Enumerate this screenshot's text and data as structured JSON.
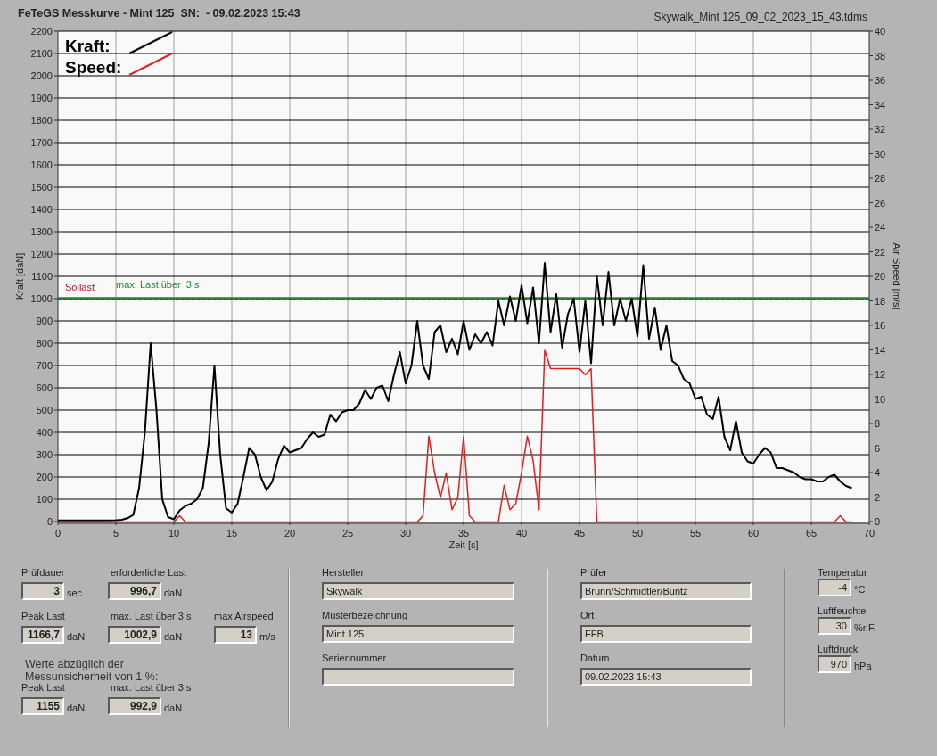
{
  "header": {
    "title": "FeTeGS Messkurve - Mint 125  SN:  - 09.02.2023 15:43",
    "file_name": "Skywalk_Mint 125_09_02_2023_15_43.tdms"
  },
  "chart": {
    "chart_data": {
      "type": "line",
      "xlabel": "Zeit [s]",
      "ylabel": "Kraft [daN]",
      "y2label": "Air Speed [m/s]",
      "xlim": [
        0,
        70
      ],
      "ylim": [
        0,
        2200
      ],
      "y2lim": [
        0,
        40
      ],
      "xticks": [
        0,
        5,
        10,
        15,
        20,
        25,
        30,
        35,
        40,
        45,
        50,
        55,
        60,
        65,
        70
      ],
      "yticks": [
        0,
        100,
        200,
        300,
        400,
        500,
        600,
        700,
        800,
        900,
        1000,
        1100,
        1200,
        1300,
        1400,
        1500,
        1600,
        1700,
        1800,
        1900,
        2000,
        2100,
        2200
      ],
      "y2ticks": [
        0,
        2,
        4,
        6,
        8,
        10,
        12,
        14,
        16,
        18,
        20,
        22,
        24,
        26,
        28,
        30,
        32,
        34,
        36,
        38,
        40
      ],
      "x": [
        0,
        0.5,
        1,
        1.5,
        2,
        2.5,
        3,
        3.5,
        4,
        4.5,
        5,
        5.5,
        6,
        6.5,
        7,
        7.5,
        8,
        8.5,
        9,
        9.5,
        10,
        10.5,
        11,
        11.5,
        12,
        12.5,
        13,
        13.5,
        14,
        14.5,
        15,
        15.5,
        16,
        16.5,
        17,
        17.5,
        18,
        18.5,
        19,
        19.5,
        20,
        20.5,
        21,
        21.5,
        22,
        22.5,
        23,
        23.5,
        24,
        24.5,
        25,
        25.5,
        26,
        26.5,
        27,
        27.5,
        28,
        28.5,
        29,
        29.5,
        30,
        30.5,
        31,
        31.5,
        32,
        32.5,
        33,
        33.5,
        34,
        34.5,
        35,
        35.5,
        36,
        36.5,
        37,
        37.5,
        38,
        38.5,
        39,
        39.5,
        40,
        40.5,
        41,
        41.5,
        42,
        42.5,
        43,
        43.5,
        44,
        44.5,
        45,
        45.5,
        46,
        46.5,
        47,
        47.5,
        48,
        48.5,
        49,
        49.5,
        50,
        50.5,
        51,
        51.5,
        52,
        52.5,
        53,
        53.5,
        54,
        54.5,
        55,
        55.5,
        56,
        56.5,
        57,
        57.5,
        58,
        58.5,
        59,
        59.5,
        60,
        60.5,
        61,
        61.5,
        62,
        62.5,
        63,
        63.5,
        64,
        64.5,
        65,
        65.5,
        66,
        66.5,
        67,
        67.5,
        68,
        68.5
      ],
      "series": [
        {
          "name": "Kraft:",
          "color": "#000000",
          "values": [
            5,
            5,
            5,
            5,
            5,
            5,
            5,
            5,
            5,
            5,
            6,
            8,
            15,
            30,
            150,
            400,
            800,
            500,
            100,
            20,
            10,
            50,
            70,
            80,
            100,
            150,
            350,
            700,
            300,
            60,
            40,
            80,
            200,
            330,
            300,
            200,
            140,
            180,
            280,
            340,
            310,
            320,
            330,
            370,
            400,
            380,
            390,
            480,
            450,
            490,
            500,
            500,
            530,
            590,
            550,
            600,
            610,
            540,
            660,
            760,
            620,
            700,
            900,
            700,
            640,
            850,
            880,
            760,
            820,
            750,
            900,
            770,
            840,
            800,
            850,
            790,
            990,
            880,
            1010,
            900,
            1060,
            890,
            1050,
            800,
            1160,
            850,
            1020,
            780,
            930,
            1000,
            760,
            990,
            710,
            1100,
            880,
            1120,
            880,
            1000,
            900,
            1000,
            830,
            1150,
            820,
            960,
            770,
            880,
            720,
            700,
            640,
            620,
            550,
            560,
            480,
            460,
            560,
            380,
            320,
            450,
            310,
            270,
            260,
            300,
            330,
            310,
            240,
            240,
            230,
            220,
            200,
            190,
            190,
            180,
            180,
            200,
            210,
            180,
            160,
            150
          ]
        },
        {
          "name": "Speed:",
          "color": "#e02020",
          "axis": "y2",
          "values": [
            0,
            0,
            0,
            0,
            0,
            0,
            0,
            0,
            0,
            0,
            0,
            0,
            0,
            0,
            0,
            0,
            0,
            0,
            0,
            0,
            0,
            0.5,
            0,
            0,
            0,
            0,
            0,
            0,
            0,
            0,
            0,
            0,
            0,
            0,
            0,
            0,
            0,
            0,
            0,
            0,
            0,
            0,
            0,
            0,
            0,
            0,
            0,
            0,
            0,
            0,
            0,
            0,
            0,
            0,
            0,
            0,
            0,
            0,
            0,
            0,
            0,
            0,
            0,
            0.5,
            7,
            4,
            2,
            4,
            1,
            2,
            7,
            0.5,
            0,
            0,
            0,
            0,
            0,
            3,
            1,
            1.5,
            4,
            7,
            5,
            1,
            14,
            12.5,
            12.5,
            12.5,
            12.5,
            12.5,
            12.5,
            12,
            12.5,
            0,
            0,
            0,
            0,
            0,
            0,
            0,
            0,
            0,
            0,
            0,
            0,
            0,
            0,
            0,
            0,
            0,
            0,
            0,
            0,
            0,
            0,
            0,
            0,
            0,
            0,
            0,
            0,
            0,
            0,
            0,
            0,
            0,
            0,
            0,
            0,
            0,
            0,
            0,
            0,
            0,
            0,
            0.5,
            0,
            0
          ]
        }
      ],
      "ref_lines": [
        {
          "axis": "y",
          "value": 1000,
          "label": "Sollast"
        },
        {
          "axis": "y",
          "value": 1002.9,
          "label": "max. Last über  3 s"
        }
      ],
      "grid": true,
      "legend": true
    }
  },
  "results_rows": [
    [
      {
        "label": "Prüfdauer",
        "value": "3",
        "unit": "sec"
      },
      {
        "label": "erforderliche Last",
        "value": "996,7",
        "unit": "daN"
      }
    ],
    [
      {
        "label": "Peak Last",
        "value": "1166,7",
        "unit": "daN"
      },
      {
        "label": "max. Last über  3 s",
        "value": "1002,9",
        "unit": "daN"
      },
      {
        "label": "max Airspeed",
        "value": "13",
        "unit": "m/s"
      }
    ]
  ],
  "uncertainty_note": "Werte abzüglich der\nMessunsicherheit von 1  %:",
  "corrected_rows": [
    [
      {
        "label": "Peak Last",
        "value": "1155",
        "unit": "daN"
      },
      {
        "label": "max. Last über  3 s",
        "value": "992,9",
        "unit": "daN"
      }
    ]
  ],
  "glider_info": [
    {
      "label": "Hersteller",
      "value": "Skywalk"
    },
    {
      "label": "Musterbezeichnung",
      "value": "Mint 125"
    },
    {
      "label": "Seriennummer"
    }
  ],
  "test_info": [
    {
      "label": "Prüfer",
      "value": "Brunn/Schmidtler/Buntz"
    },
    {
      "label": "Ort",
      "value": "FFB"
    },
    {
      "label": "Datum",
      "value": "09.02.2023 15:43"
    }
  ],
  "conditions": [
    {
      "label": "Temperatur",
      "value": "-4",
      "unit": "°C"
    },
    {
      "label": "Luftfeuchte",
      "value": "30",
      "unit": "%r.F."
    },
    {
      "label": "Luftdruck",
      "value": "970",
      "unit": "hPa"
    }
  ]
}
